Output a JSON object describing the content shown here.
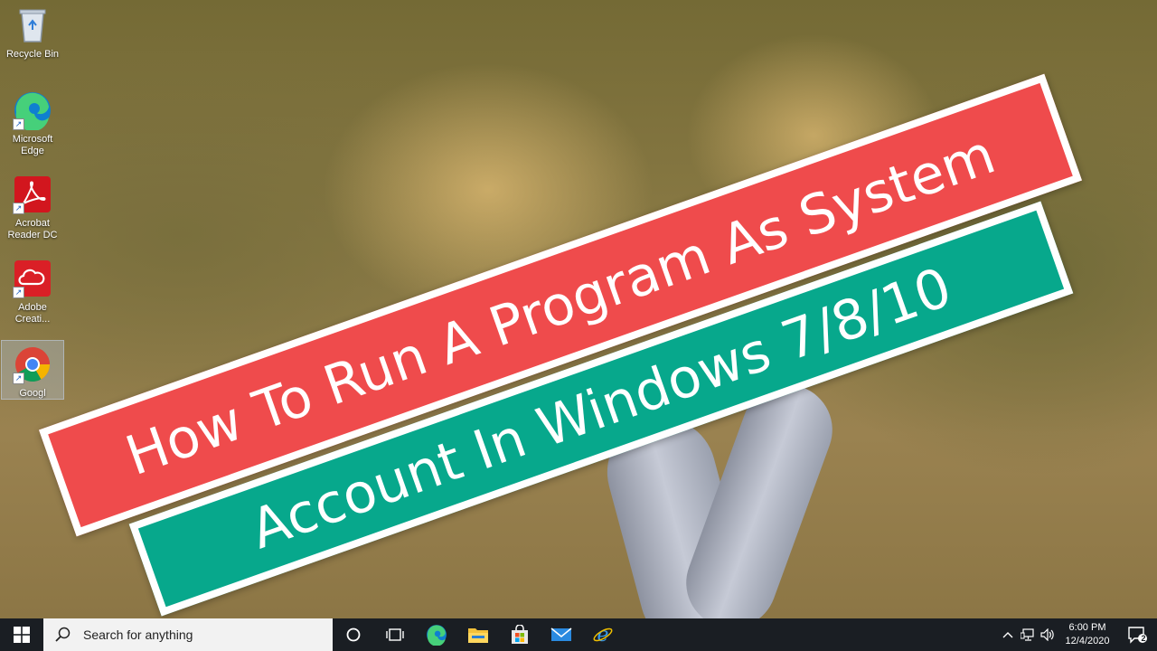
{
  "desktop": {
    "icons": [
      {
        "label": "Recycle Bin",
        "icon": "recycle-bin-icon"
      },
      {
        "label": "Microsoft Edge",
        "icon": "edge-icon"
      },
      {
        "label": "Acrobat Reader DC",
        "icon": "acrobat-icon"
      },
      {
        "label": "Adobe Creati...",
        "icon": "creative-cloud-icon"
      },
      {
        "label": "Googl",
        "icon": "chrome-icon"
      }
    ]
  },
  "banners": {
    "line1": "How To Run A Program As System",
    "line2": "Account In Windows 7/8/10"
  },
  "colors": {
    "red_banner": "#ef4b4c",
    "green_banner": "#07a88c",
    "taskbar": "#1a1e23"
  },
  "taskbar": {
    "search_placeholder": "Search for anything",
    "pinned": [
      "cortana-circle-icon",
      "task-view-icon",
      "edge-icon",
      "file-explorer-icon",
      "store-icon",
      "mail-icon",
      "internet-explorer-icon"
    ],
    "time": "6:00 PM",
    "date": "12/4/2020",
    "notification_count": "2"
  }
}
